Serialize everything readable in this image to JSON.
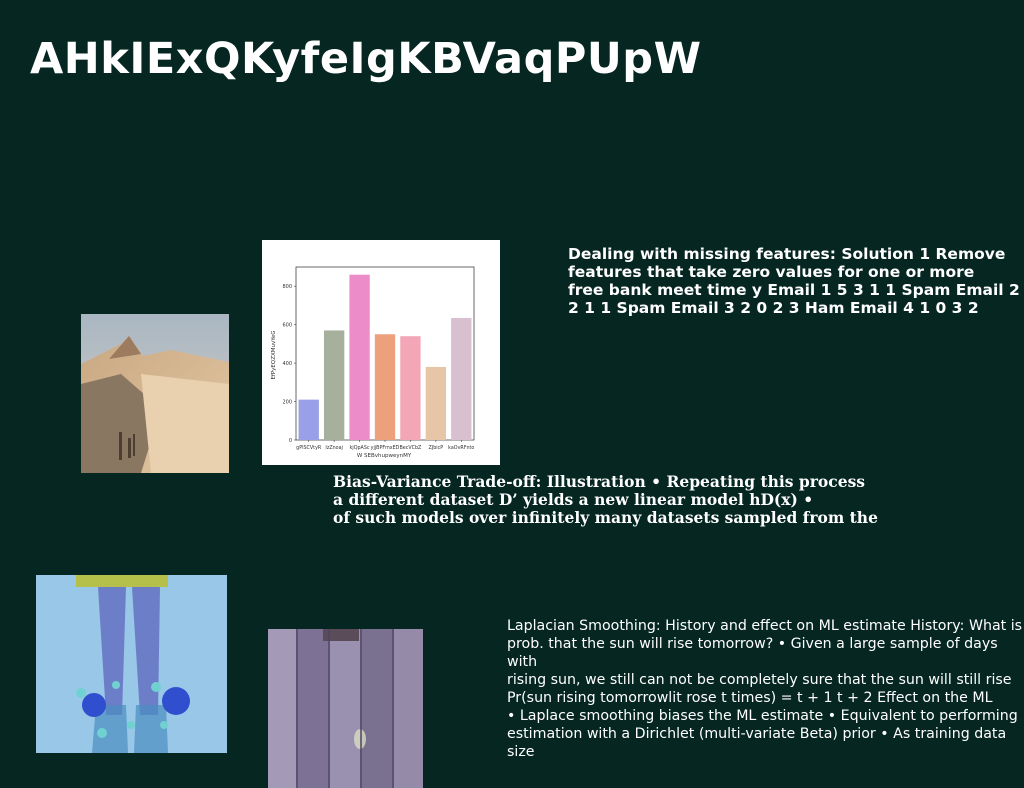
{
  "page": {
    "background": "#052621",
    "title": "AHkIExQKyfeIgKBVaqPUpW"
  },
  "text_blocks": {
    "missing_features": "Dealing with missing features: Solution 1 Remove\nfeatures that take zero values for one or more\nfree bank meet time y Email 1 5 3 1 1 Spam Email 2\n2 1 1 Spam Email 3 2 0 2 3 Ham Email 4 1 0 3 2",
    "bias_variance": "Bias-Variance Trade-off: Illustration • Repeating this process\na different dataset D’ yields a new linear model hD(x) •\nof such models over infinitely many datasets sampled from the",
    "laplacian": "Laplacian Smoothing: History and effect on ML estimate History: What is\nprob. that the sun will rise tomorrow? • Given a large sample of days with\nrising sun, we still can not be completely sure that the sun will still rise\nPr(sun rising tomorrowlit rose t times) = t + 1 t + 2 Effect on the ML\n• Laplace smoothing biases the ML estimate • Equivalent to performing\nestimation with a Dirichlet (multi-variate Beta) prior • As training data size"
  },
  "images": {
    "desert": "desert-dunes-photo",
    "legs": "legs-with-blue-flowers-photo",
    "wood": "weathered-wooden-door-photo"
  },
  "chart_data": {
    "type": "bar",
    "categories": [
      "gPISCVtyR",
      "IzZnoaj",
      "kjQpASc",
      "yjjBPFmxED",
      "BecVCbZ",
      "ZJbicP",
      "kaOvRFnto"
    ],
    "values": [
      210,
      570,
      860,
      550,
      540,
      380,
      635
    ],
    "colors": [
      "#9aa0e8",
      "#a7b09d",
      "#ec8cc8",
      "#eca07c",
      "#f2a6b6",
      "#e6c6a6",
      "#d8c0d0"
    ],
    "xlabel": "W SEBvhupweynMY",
    "ylabel": "EfPyEQZXMuvYeG",
    "yticks": [
      0,
      200,
      400,
      600,
      800
    ],
    "ylim": [
      0,
      900
    ],
    "grid": false,
    "legend": "none"
  }
}
